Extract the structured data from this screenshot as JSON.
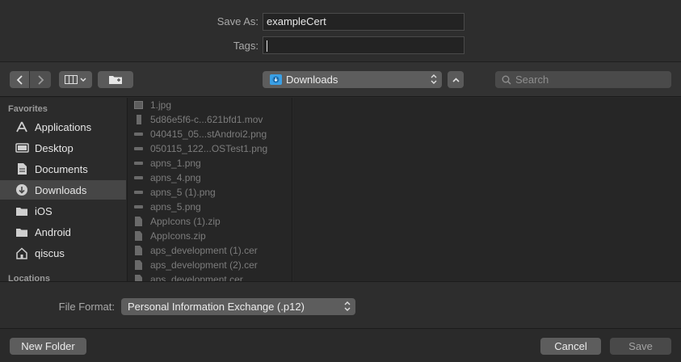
{
  "save_as": {
    "label": "Save As:",
    "value": "exampleCert"
  },
  "tags": {
    "label": "Tags:",
    "value": ""
  },
  "toolbar": {
    "back_icon": "chevron-left-icon",
    "forward_icon": "chevron-right-icon",
    "view_icon": "column-view-icon",
    "new_folder_icon": "folder-plus-icon",
    "location": "Downloads",
    "search_placeholder": "Search"
  },
  "sidebar": {
    "favorites_title": "Favorites",
    "locations_title": "Locations",
    "items": [
      {
        "label": "Applications",
        "icon": "applications-icon",
        "selected": false
      },
      {
        "label": "Desktop",
        "icon": "desktop-icon",
        "selected": false
      },
      {
        "label": "Documents",
        "icon": "documents-icon",
        "selected": false
      },
      {
        "label": "Downloads",
        "icon": "downloads-icon",
        "selected": true
      },
      {
        "label": "iOS",
        "icon": "folder-icon",
        "selected": false
      },
      {
        "label": "Android",
        "icon": "folder-icon",
        "selected": false
      },
      {
        "label": "qiscus",
        "icon": "home-icon",
        "selected": false
      }
    ]
  },
  "files": [
    {
      "name": "1.jpg",
      "kind": "picture"
    },
    {
      "name": "5d86e5f6-c...621bfd1.mov",
      "kind": "movie"
    },
    {
      "name": "040415_05...stAndroi2.png",
      "kind": "image"
    },
    {
      "name": "050115_122...OSTest1.png",
      "kind": "image"
    },
    {
      "name": "apns_1.png",
      "kind": "image"
    },
    {
      "name": "apns_4.png",
      "kind": "image"
    },
    {
      "name": "apns_5 (1).png",
      "kind": "image"
    },
    {
      "name": "apns_5.png",
      "kind": "image"
    },
    {
      "name": "AppIcons (1).zip",
      "kind": "document"
    },
    {
      "name": "AppIcons.zip",
      "kind": "document"
    },
    {
      "name": "aps_development (1).cer",
      "kind": "document"
    },
    {
      "name": "aps_development (2).cer",
      "kind": "document"
    },
    {
      "name": "aps_development.cer",
      "kind": "document"
    }
  ],
  "file_format": {
    "label": "File Format:",
    "value": "Personal Information Exchange (.p12)"
  },
  "buttons": {
    "new_folder": "New Folder",
    "cancel": "Cancel",
    "save": "Save"
  }
}
